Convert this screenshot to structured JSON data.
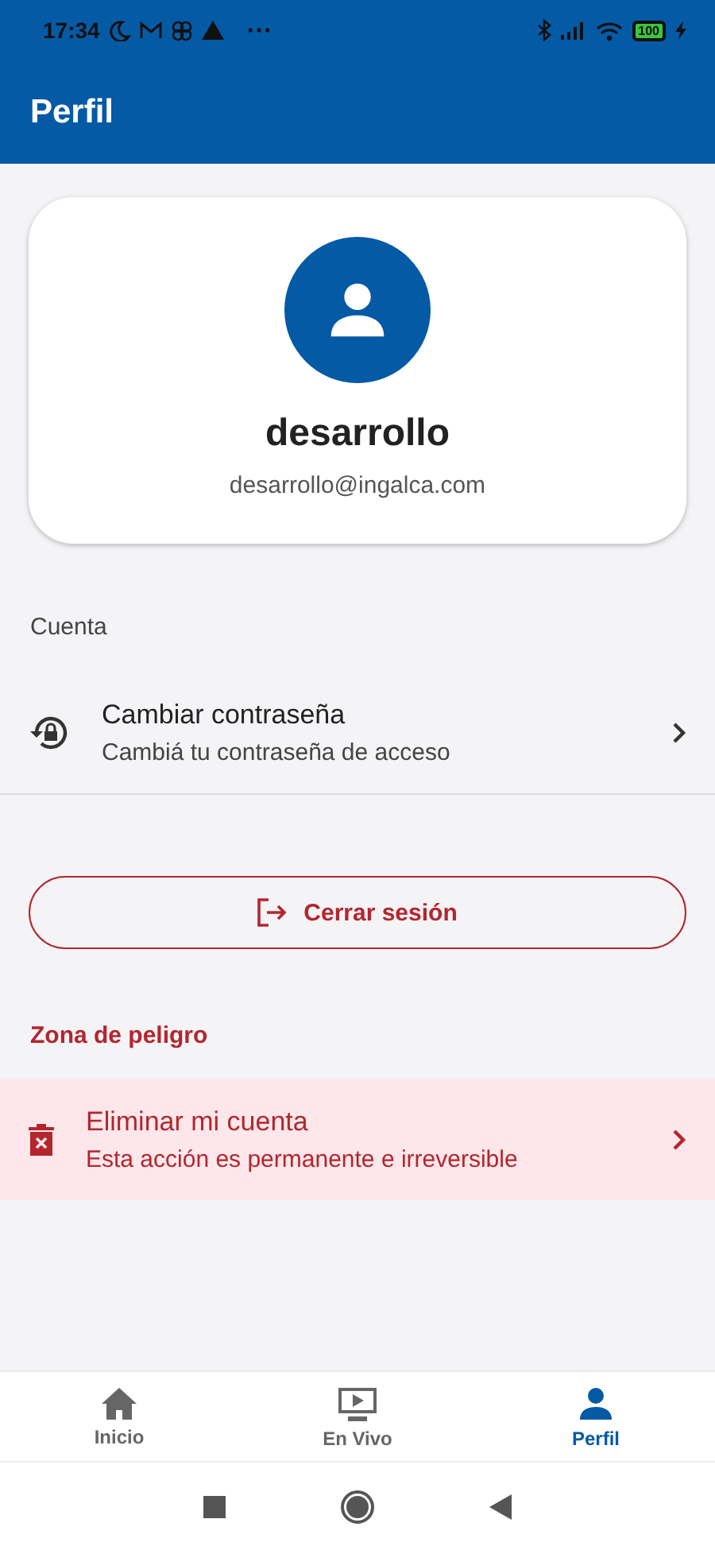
{
  "status_bar": {
    "time": "17:34",
    "more": "⋯",
    "battery": "100"
  },
  "app_bar": {
    "title": "Perfil"
  },
  "profile": {
    "name": "desarrollo",
    "email": "desarrollo@ingalca.com"
  },
  "account_section": {
    "title": "Cuenta",
    "items": [
      {
        "title": "Cambiar contraseña",
        "subtitle": "Cambiá tu contraseña de acceso"
      }
    ]
  },
  "logout_button": {
    "label": "Cerrar sesión"
  },
  "danger_section": {
    "title": "Zona de peligro",
    "items": [
      {
        "title": "Eliminar mi cuenta",
        "subtitle": "Esta acción es permanente e irreversible"
      }
    ]
  },
  "bottom_nav": [
    {
      "label": "Inicio",
      "kind": "home",
      "selected": false
    },
    {
      "label": "En Vivo",
      "kind": "live",
      "selected": false
    },
    {
      "label": "Perfil",
      "kind": "profile",
      "selected": true
    }
  ]
}
